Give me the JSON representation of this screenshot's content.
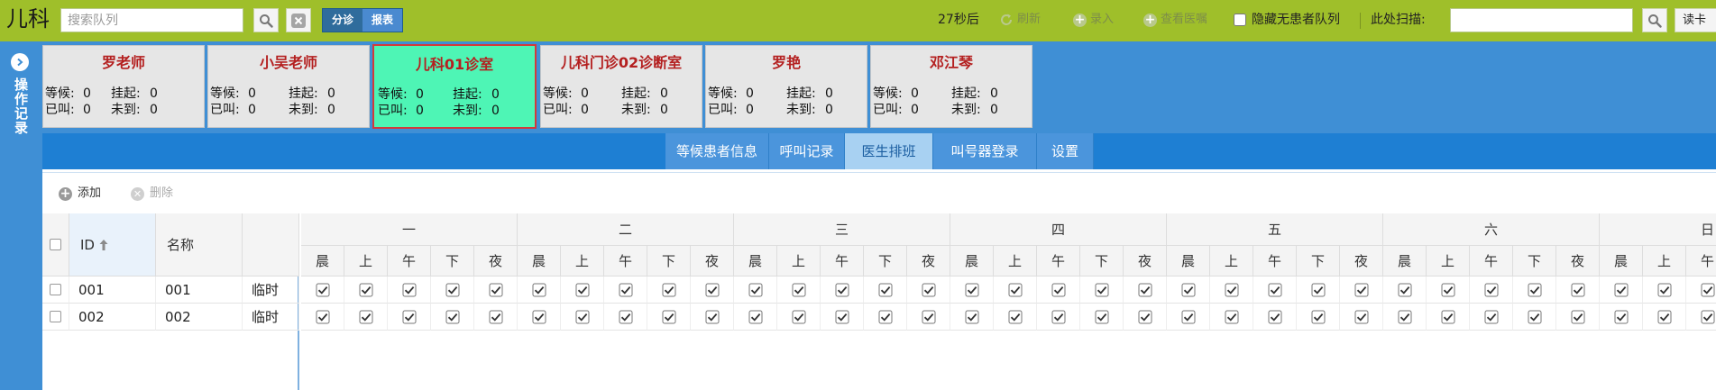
{
  "app_title": "儿科",
  "search": {
    "placeholder": "搜索队列",
    "value": ""
  },
  "mode_tabs": [
    {
      "label": "分诊",
      "active": true
    },
    {
      "label": "报表",
      "active": false
    }
  ],
  "countdown": "27秒后",
  "toolbar_actions": [
    "刷新",
    "录入",
    "查看医嘱"
  ],
  "hide_empty_label": "隐藏无患者队列",
  "scan": {
    "label": "此处扫描:",
    "value": ""
  },
  "read_card_label": "读卡",
  "side_panel_label": "操作记录",
  "rooms": [
    {
      "name": "罗老师",
      "waiting_label": "等候:",
      "waiting": "0",
      "pending_label": "挂起:",
      "pending": "0",
      "called_label": "已叫:",
      "called": "0",
      "absent_label": "未到:",
      "absent": "0",
      "active": false
    },
    {
      "name": "小吴老师",
      "waiting_label": "等候:",
      "waiting": "0",
      "pending_label": "挂起:",
      "pending": "0",
      "called_label": "已叫:",
      "called": "0",
      "absent_label": "未到:",
      "absent": "0",
      "active": false
    },
    {
      "name": "儿科01诊室",
      "waiting_label": "等候:",
      "waiting": "0",
      "pending_label": "挂起:",
      "pending": "0",
      "called_label": "已叫:",
      "called": "0",
      "absent_label": "未到:",
      "absent": "0",
      "active": true
    },
    {
      "name": "儿科门诊02诊断室",
      "waiting_label": "等候:",
      "waiting": "0",
      "pending_label": "挂起:",
      "pending": "0",
      "called_label": "已叫:",
      "called": "0",
      "absent_label": "未到:",
      "absent": "0",
      "active": false
    },
    {
      "name": "罗艳",
      "waiting_label": "等候:",
      "waiting": "0",
      "pending_label": "挂起:",
      "pending": "0",
      "called_label": "已叫:",
      "called": "0",
      "absent_label": "未到:",
      "absent": "0",
      "active": false
    },
    {
      "name": "邓江琴",
      "waiting_label": "等候:",
      "waiting": "0",
      "pending_label": "挂起:",
      "pending": "0",
      "called_label": "已叫:",
      "called": "0",
      "absent_label": "未到:",
      "absent": "0",
      "active": false
    }
  ],
  "tabs": [
    {
      "label": "等候患者信息",
      "active": false
    },
    {
      "label": "呼叫记录",
      "active": false
    },
    {
      "label": "医生排班",
      "active": true
    },
    {
      "label": "叫号器登录",
      "active": false
    },
    {
      "label": "设置",
      "active": false
    }
  ],
  "grid_toolbar": {
    "add_label": "添加",
    "delete_label": "删除"
  },
  "grid": {
    "col_id": "ID",
    "col_name": "名称",
    "days": [
      "一",
      "二",
      "三",
      "四",
      "五",
      "六",
      "日"
    ],
    "slots": [
      "晨",
      "上",
      "午",
      "下",
      "夜"
    ],
    "rows": [
      {
        "id": "001",
        "name": "001",
        "type": "临时"
      },
      {
        "id": "002",
        "name": "002",
        "type": "临时"
      }
    ]
  }
}
